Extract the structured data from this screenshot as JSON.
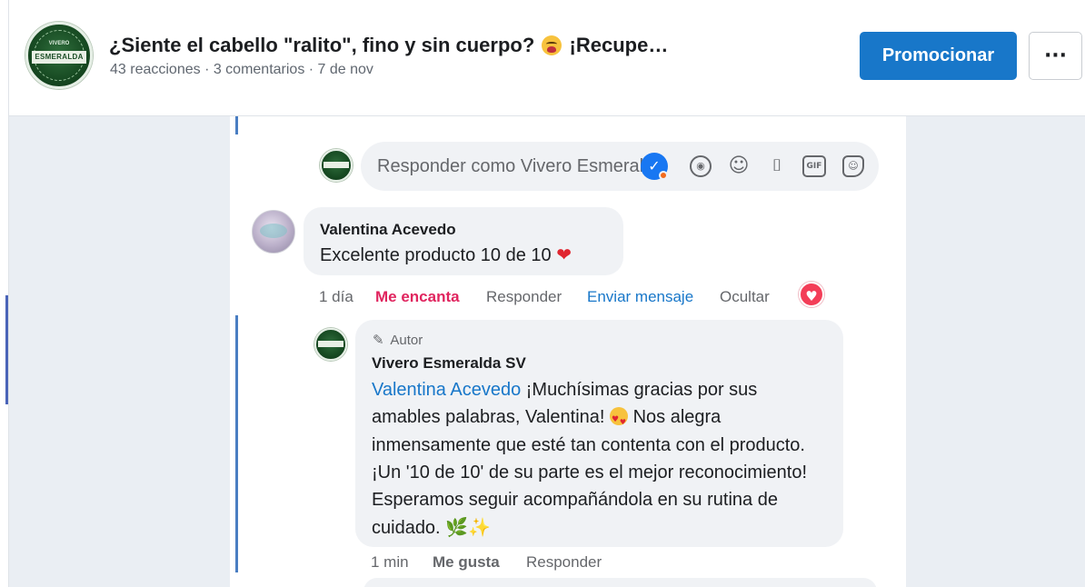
{
  "header": {
    "logo_text": "ESMERALDA",
    "logo_small": "VIVERO",
    "title": "¿Siente el cabello \"ralito\", fino y sin cuerpo?",
    "title_suffix": "¡Recupe…",
    "meta": "43 reacciones · 3 comentarios · 7 de nov",
    "promote_label": "Promocionar",
    "more_label": "···"
  },
  "composer": {
    "placeholder": "Responder como Vivero Esmeralda SV",
    "verified_glyph": "✓",
    "icons": [
      "avatar-icon",
      "smile-icon",
      "camera-icon",
      "gif-icon",
      "sticker-icon"
    ],
    "gif_label": "GIF"
  },
  "comment": {
    "author": "Valentina Acevedo",
    "text": "Excelente producto 10 de 10",
    "heart": "❤",
    "time": "1 día",
    "love_label": "Me encanta",
    "reply_label": "Responder",
    "message_label": "Enviar mensaje",
    "hide_label": "Ocultar"
  },
  "reply": {
    "badge": "Autor",
    "author": "Vivero Esmeralda SV",
    "mention": "Valentina Acevedo",
    "text_1": " ¡Muchísimas gracias por sus amables palabras, Valentina! ",
    "text_2": " Nos alegra inmensamente que esté tan contenta con el producto. ¡Un '10 de 10' de su parte es el mejor reconocimiento! Esperamos seguir acompañándola en su rutina de cuidado. ",
    "herb": "🌿",
    "sparkle": "✨",
    "time": "1 min",
    "like_label": "Me gusta",
    "reply_label": "Responder"
  },
  "colors": {
    "primary": "#1877c9",
    "love": "#e0245e",
    "thread_line": "#4a7ec2"
  }
}
